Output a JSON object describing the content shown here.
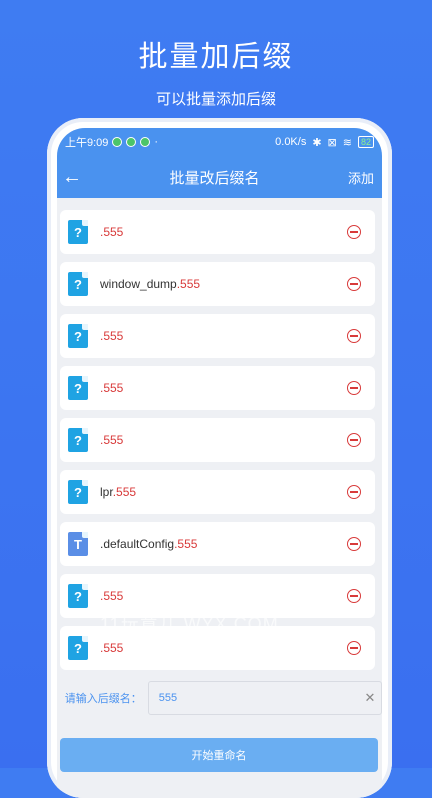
{
  "headline": {
    "title": "批量加后缀",
    "subtitle": "可以批量添加后缀"
  },
  "status_bar": {
    "time": "上午9:09",
    "network_speed": "0.0K/s",
    "battery": "82"
  },
  "app_bar": {
    "title": "批量改后缀名",
    "add_label": "添加"
  },
  "files": [
    {
      "icon": "question-file-icon",
      "name": "",
      "ext": ".555"
    },
    {
      "icon": "question-file-icon",
      "name": "window_dump",
      "ext": ".555"
    },
    {
      "icon": "question-file-icon",
      "name": "",
      "ext": ".555"
    },
    {
      "icon": "question-file-icon",
      "name": "",
      "ext": ".555"
    },
    {
      "icon": "question-file-icon",
      "name": "",
      "ext": ".555"
    },
    {
      "icon": "question-file-icon",
      "name": "lpr",
      "ext": ".555"
    },
    {
      "icon": "text-file-icon",
      "name": ".defaultConfig",
      "ext": ".555"
    },
    {
      "icon": "question-file-icon",
      "name": "",
      "ext": ".555"
    },
    {
      "icon": "question-file-icon",
      "name": "",
      "ext": ".555"
    }
  ],
  "suffix": {
    "label": "请输入后缀名：",
    "value": "555"
  },
  "start_button": {
    "label": "开始重命名"
  },
  "watermark": "11玩意儿 WYX.COM",
  "colors": {
    "accent": "#4a92ef",
    "remove": "#d83a3a"
  }
}
